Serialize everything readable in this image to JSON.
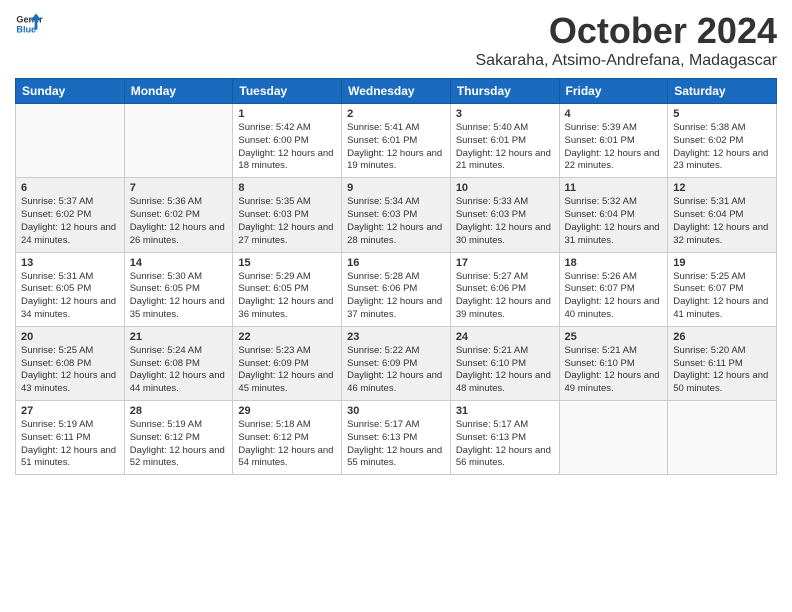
{
  "header": {
    "logo_line1": "General",
    "logo_line2": "Blue",
    "month": "October 2024",
    "location": "Sakaraha, Atsimo-Andrefana, Madagascar"
  },
  "weekdays": [
    "Sunday",
    "Monday",
    "Tuesday",
    "Wednesday",
    "Thursday",
    "Friday",
    "Saturday"
  ],
  "weeks": [
    [
      {
        "day": "",
        "content": ""
      },
      {
        "day": "",
        "content": ""
      },
      {
        "day": "1",
        "content": "Sunrise: 5:42 AM\nSunset: 6:00 PM\nDaylight: 12 hours and 18 minutes."
      },
      {
        "day": "2",
        "content": "Sunrise: 5:41 AM\nSunset: 6:01 PM\nDaylight: 12 hours and 19 minutes."
      },
      {
        "day": "3",
        "content": "Sunrise: 5:40 AM\nSunset: 6:01 PM\nDaylight: 12 hours and 21 minutes."
      },
      {
        "day": "4",
        "content": "Sunrise: 5:39 AM\nSunset: 6:01 PM\nDaylight: 12 hours and 22 minutes."
      },
      {
        "day": "5",
        "content": "Sunrise: 5:38 AM\nSunset: 6:02 PM\nDaylight: 12 hours and 23 minutes."
      }
    ],
    [
      {
        "day": "6",
        "content": "Sunrise: 5:37 AM\nSunset: 6:02 PM\nDaylight: 12 hours and 24 minutes."
      },
      {
        "day": "7",
        "content": "Sunrise: 5:36 AM\nSunset: 6:02 PM\nDaylight: 12 hours and 26 minutes."
      },
      {
        "day": "8",
        "content": "Sunrise: 5:35 AM\nSunset: 6:03 PM\nDaylight: 12 hours and 27 minutes."
      },
      {
        "day": "9",
        "content": "Sunrise: 5:34 AM\nSunset: 6:03 PM\nDaylight: 12 hours and 28 minutes."
      },
      {
        "day": "10",
        "content": "Sunrise: 5:33 AM\nSunset: 6:03 PM\nDaylight: 12 hours and 30 minutes."
      },
      {
        "day": "11",
        "content": "Sunrise: 5:32 AM\nSunset: 6:04 PM\nDaylight: 12 hours and 31 minutes."
      },
      {
        "day": "12",
        "content": "Sunrise: 5:31 AM\nSunset: 6:04 PM\nDaylight: 12 hours and 32 minutes."
      }
    ],
    [
      {
        "day": "13",
        "content": "Sunrise: 5:31 AM\nSunset: 6:05 PM\nDaylight: 12 hours and 34 minutes."
      },
      {
        "day": "14",
        "content": "Sunrise: 5:30 AM\nSunset: 6:05 PM\nDaylight: 12 hours and 35 minutes."
      },
      {
        "day": "15",
        "content": "Sunrise: 5:29 AM\nSunset: 6:05 PM\nDaylight: 12 hours and 36 minutes."
      },
      {
        "day": "16",
        "content": "Sunrise: 5:28 AM\nSunset: 6:06 PM\nDaylight: 12 hours and 37 minutes."
      },
      {
        "day": "17",
        "content": "Sunrise: 5:27 AM\nSunset: 6:06 PM\nDaylight: 12 hours and 39 minutes."
      },
      {
        "day": "18",
        "content": "Sunrise: 5:26 AM\nSunset: 6:07 PM\nDaylight: 12 hours and 40 minutes."
      },
      {
        "day": "19",
        "content": "Sunrise: 5:25 AM\nSunset: 6:07 PM\nDaylight: 12 hours and 41 minutes."
      }
    ],
    [
      {
        "day": "20",
        "content": "Sunrise: 5:25 AM\nSunset: 6:08 PM\nDaylight: 12 hours and 43 minutes."
      },
      {
        "day": "21",
        "content": "Sunrise: 5:24 AM\nSunset: 6:08 PM\nDaylight: 12 hours and 44 minutes."
      },
      {
        "day": "22",
        "content": "Sunrise: 5:23 AM\nSunset: 6:09 PM\nDaylight: 12 hours and 45 minutes."
      },
      {
        "day": "23",
        "content": "Sunrise: 5:22 AM\nSunset: 6:09 PM\nDaylight: 12 hours and 46 minutes."
      },
      {
        "day": "24",
        "content": "Sunrise: 5:21 AM\nSunset: 6:10 PM\nDaylight: 12 hours and 48 minutes."
      },
      {
        "day": "25",
        "content": "Sunrise: 5:21 AM\nSunset: 6:10 PM\nDaylight: 12 hours and 49 minutes."
      },
      {
        "day": "26",
        "content": "Sunrise: 5:20 AM\nSunset: 6:11 PM\nDaylight: 12 hours and 50 minutes."
      }
    ],
    [
      {
        "day": "27",
        "content": "Sunrise: 5:19 AM\nSunset: 6:11 PM\nDaylight: 12 hours and 51 minutes."
      },
      {
        "day": "28",
        "content": "Sunrise: 5:19 AM\nSunset: 6:12 PM\nDaylight: 12 hours and 52 minutes."
      },
      {
        "day": "29",
        "content": "Sunrise: 5:18 AM\nSunset: 6:12 PM\nDaylight: 12 hours and 54 minutes."
      },
      {
        "day": "30",
        "content": "Sunrise: 5:17 AM\nSunset: 6:13 PM\nDaylight: 12 hours and 55 minutes."
      },
      {
        "day": "31",
        "content": "Sunrise: 5:17 AM\nSunset: 6:13 PM\nDaylight: 12 hours and 56 minutes."
      },
      {
        "day": "",
        "content": ""
      },
      {
        "day": "",
        "content": ""
      }
    ]
  ]
}
